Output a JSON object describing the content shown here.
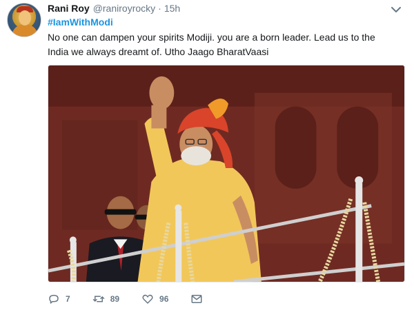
{
  "tweet": {
    "author_name": "Rani Roy",
    "author_handle": "@raniroyrocky",
    "separator": "·",
    "time": "15h",
    "hashtag": "#IamWithModi",
    "text": "No one can dampen your spirits Modiji. you are a born leader. Lead us to the India we always dreamt of. Utho Jaago BharatVaasi"
  },
  "actions": {
    "reply_icon": "reply-icon",
    "reply_count": "7",
    "retweet_icon": "retweet-icon",
    "retweet_count": "89",
    "like_icon": "heart-icon",
    "like_count": "96",
    "dm_icon": "envelope-icon"
  },
  "colors": {
    "link_blue": "#1b95e0",
    "secondary_text": "#657786",
    "primary_text": "#14171a"
  }
}
